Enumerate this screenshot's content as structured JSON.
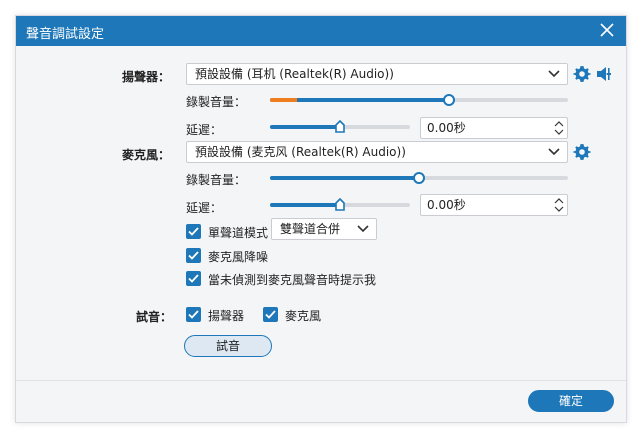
{
  "dialog": {
    "title": "聲音調試設定"
  },
  "speaker": {
    "label": "揚聲器：",
    "device": "預設設備 (耳机 (Realtek(R) Audio))",
    "volume_label": "錄製音量：",
    "volume_level": 0.6,
    "volume_warn_level": 0.09,
    "delay_label": "延遲：",
    "delay_level": 0.5,
    "delay_value": "0.00秒"
  },
  "microphone": {
    "label": "麥克風：",
    "device": "預設設備 (麦克风 (Realtek(R) Audio))",
    "volume_label": "錄製音量：",
    "volume_level": 0.5,
    "delay_label": "延遲：",
    "delay_level": 0.5,
    "delay_value": "0.00秒",
    "mono_mode_label": "單聲道模式",
    "mono_mode_checked": true,
    "mono_mode_option": "雙聲道合併",
    "noise_reduction_label": "麥克風降噪",
    "noise_reduction_checked": true,
    "no_mic_prompt_label": "當未偵測到麥克風聲音時提示我",
    "no_mic_prompt_checked": true
  },
  "test": {
    "label": "試音：",
    "speaker_label": "揚聲器",
    "speaker_checked": true,
    "mic_label": "麥克風",
    "mic_checked": true,
    "button_label": "試音"
  },
  "footer": {
    "confirm_label": "確定"
  },
  "colors": {
    "accent": "#1e77b8",
    "warn": "#f07d1e"
  }
}
